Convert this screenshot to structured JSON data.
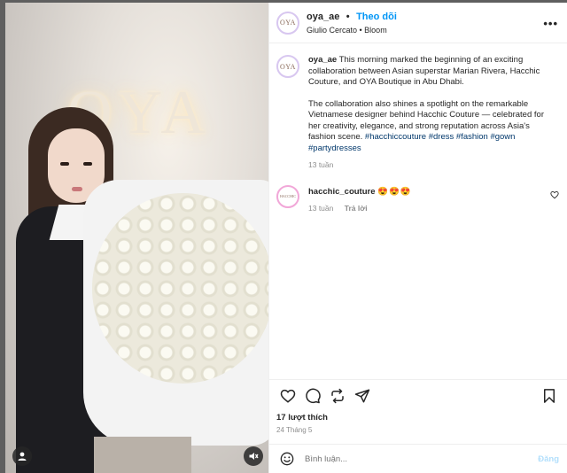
{
  "header": {
    "username": "oya_ae",
    "separator": "•",
    "follow_label": "Theo dõi",
    "subtitle": "Giulio Cercato • Bloom",
    "more_label": "•••"
  },
  "media": {
    "wall_logo_text": "OYA",
    "user_tag_icon": "user-tag-icon",
    "mute_icon": "muted-speaker-icon"
  },
  "avatars": {
    "oya_text": "OYA",
    "hacchic_text": "HACCHIC"
  },
  "caption": {
    "username": "oya_ae",
    "paragraph1": "This morning marked the beginning of an exciting collaboration between Asian superstar Marian Rivera, Hacchic Couture, and OYA Boutique in Abu Dhabi.",
    "paragraph2": "The collaboration also shines a spotlight on the remarkable Vietnamese designer behind Hacchic Couture — celebrated for her creativity, elegance, and strong reputation across Asia's fashion scene.",
    "hashtags": [
      "#hacchiccouture",
      "#dress",
      "#fashion",
      "#gown",
      "#partydresses"
    ],
    "time": "13 tuần"
  },
  "comment": {
    "username": "hacchic_couture",
    "text": "😍😍😍",
    "time": "13 tuần",
    "reply_label": "Trả lời"
  },
  "stats": {
    "likes": "17 lượt thích",
    "date": "24 Tháng 5"
  },
  "composer": {
    "placeholder": "Bình luận...",
    "post_label": "Đăng"
  },
  "icons": [
    "heart-icon",
    "comment-icon",
    "repost-icon",
    "share-icon",
    "bookmark-icon",
    "emoji-icon"
  ],
  "colors": {
    "link_blue": "#0095f6",
    "hashtag": "#00376b",
    "muted_text": "#8e8e8e",
    "post_disabled": "#b2dffc"
  }
}
